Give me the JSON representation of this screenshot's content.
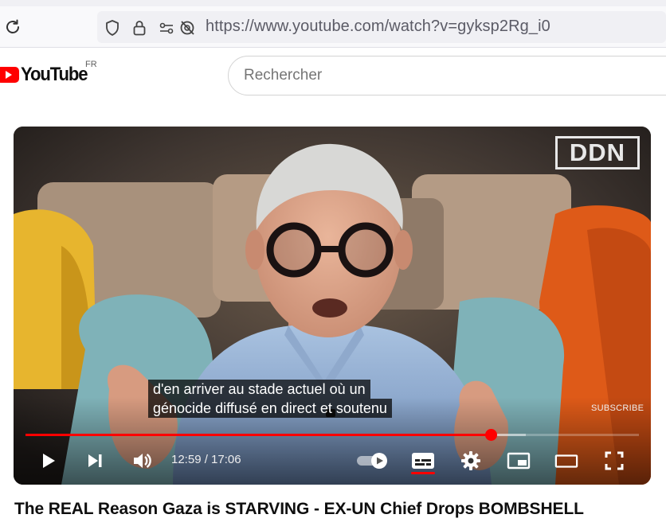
{
  "browser": {
    "url": "https://www.youtube.com/watch?v=gyksp2Rg_i0",
    "icons": [
      "reload-icon",
      "shield-icon",
      "lock-icon",
      "permissions-icon",
      "tracking-blocked-icon"
    ]
  },
  "header": {
    "brand": "YouTube",
    "region": "FR",
    "search_placeholder": "Rechercher"
  },
  "player": {
    "channel_logo": "DDN",
    "subscribe_watermark": "SUBSCRIBE",
    "caption_line1": "d'en arriver au stade actuel où un",
    "caption_line2": "génocide diffusé en direct et soutenu",
    "time_display": "12:59 / 17:06",
    "progress_fraction": 0.759,
    "buffered_fraction": 0.815,
    "accent_color": "#ff0000",
    "controls": [
      "play-icon",
      "next-icon",
      "volume-icon",
      "autoplay-toggle",
      "subtitles-icon",
      "settings-icon",
      "miniplayer-icon",
      "theater-icon",
      "fullscreen-icon"
    ]
  },
  "video": {
    "title": "The REAL Reason Gaza is STARVING - EX-UN Chief Drops BOMBSHELL"
  }
}
